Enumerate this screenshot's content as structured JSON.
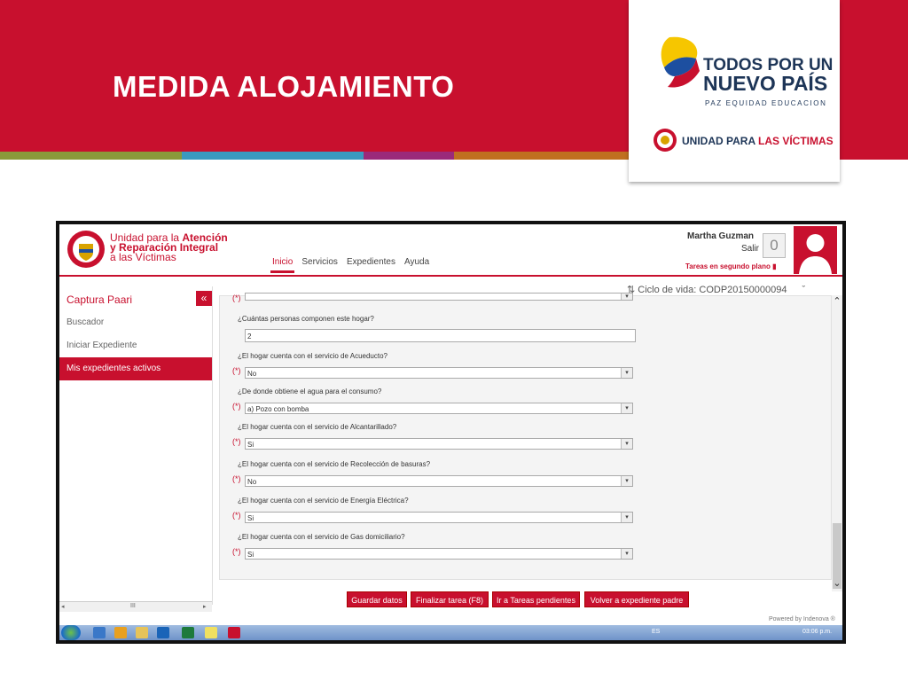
{
  "slide": {
    "title": "MEDIDA ALOJAMIENTO",
    "stripe_colors": [
      "#8a9a3a",
      "#8a9a3a",
      "#3a9ac0",
      "#3a9ac0",
      "#9b2a7a",
      "#c07020",
      "#c07020",
      "#c8102e",
      "#7a7a2a",
      "#c8102e"
    ]
  },
  "logos": {
    "gov_line1": "TODOS POR UN",
    "gov_line2": "NUEVO PAÍS",
    "gov_sub": "PAZ  EQUIDAD  EDUCACION",
    "unit_prefix": "UNIDAD PARA ",
    "unit_bold": "LAS VÍCTIMAS"
  },
  "app": {
    "org_line1a": "Unidad para la ",
    "org_line1b": "Atención",
    "org_line2": "y Reparación Integral",
    "org_line3": "a las Víctimas",
    "nav": [
      "Inicio",
      "Servicios",
      "Expedientes",
      "Ayuda"
    ],
    "user_name": "Martha Guzman",
    "logout": "Salir",
    "task_count": "0",
    "background_tasks": "Tareas en segundo plano",
    "lifecycle": "Ciclo de vida: CODP20150000094",
    "sidebar": {
      "title": "Captura Paari",
      "collapse": "«",
      "items": [
        "Buscador",
        "Iniciar Expediente",
        "Mis expedientes activos"
      ],
      "active_index": 2,
      "scroll_label": "III"
    },
    "form": {
      "partial_top_prefix": "(*)",
      "required_mark": "(*)",
      "q1_label": "¿Cuántas personas componen este hogar?",
      "q1_value": "2",
      "questions": [
        {
          "label": "¿El hogar cuenta con el servicio de Acueducto?",
          "value": "No"
        },
        {
          "label": "¿De donde obtiene el agua para el consumo?",
          "value": "a) Pozo con bomba"
        },
        {
          "label": "¿El hogar cuenta con el servicio de Alcantarillado?",
          "value": "Si"
        },
        {
          "label": "¿El hogar cuenta con el servicio de Recolección de basuras?",
          "value": "No"
        },
        {
          "label": "¿El hogar cuenta con el servicio de Energía Eléctrica?",
          "value": "Si"
        },
        {
          "label": "¿El hogar cuenta con el servicio de Gas domiciliario?",
          "value": "Si"
        }
      ]
    },
    "buttons": {
      "save": "Guardar datos",
      "finish": "Finalizar tarea (F8)",
      "pending": "Ir a Tareas pendientes",
      "back": "Volver a expediente padre"
    },
    "powered": "Powered by Indenova ®"
  },
  "taskbar": {
    "lang": "ES",
    "time": "03:06 p.m."
  }
}
